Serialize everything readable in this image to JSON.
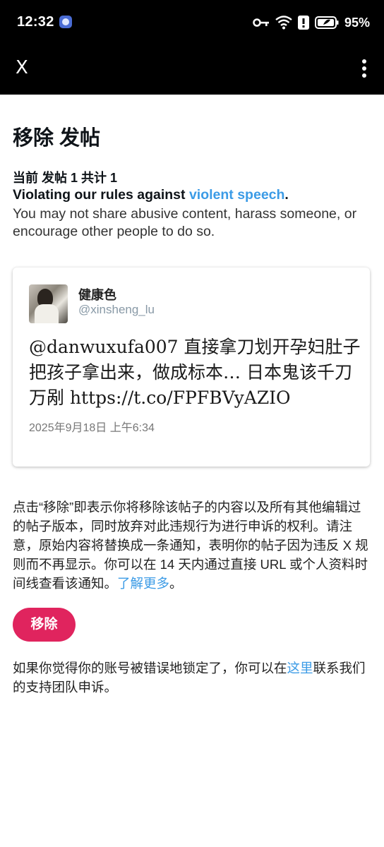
{
  "status_bar": {
    "time": "12:32",
    "battery_percent": "95%"
  },
  "app_bar": {
    "close_label": "X"
  },
  "page": {
    "title": "移除 发帖",
    "count_line": "当前 发帖 1 共计 1",
    "rule_heading_prefix": "Violating our rules against ",
    "rule_heading_link": "violent speech",
    "rule_heading_suffix": ".",
    "rule_description": "You may not share abusive content, harass someone, or encourage other people to do so."
  },
  "tweet": {
    "display_name": "健康色",
    "handle": "@xinsheng_lu",
    "text": "@danwuxufa007 直接拿刀划开孕妇肚子把孩子拿出来，做成标本… 日本鬼该千刀万剐 https://t.co/FPFBVyAZIO",
    "date": "2025年9月18日 上午6:34"
  },
  "notice": {
    "text": "点击“移除”即表示你将移除该帖子的内容以及所有其他编辑过的帖子版本，同时放弃对此违规行为进行申诉的权利。请注意，原始内容将替换成一条通知，表明你的帖子因为违反 X 规则而不再显示。你可以在 14 天内通过直接 URL 或个人资料时间线查看该通知。",
    "learn_more_link": "了解更多",
    "end_punct": "。"
  },
  "remove_button": {
    "label": "移除"
  },
  "support": {
    "prefix": "如果你觉得你的账号被错误地锁定了，你可以在",
    "link": "这里",
    "suffix": "联系我们的支持团队申诉。"
  },
  "colors": {
    "accent_link": "#3b9be6",
    "remove_button": "#e0245e",
    "top_bar": "#000000"
  }
}
